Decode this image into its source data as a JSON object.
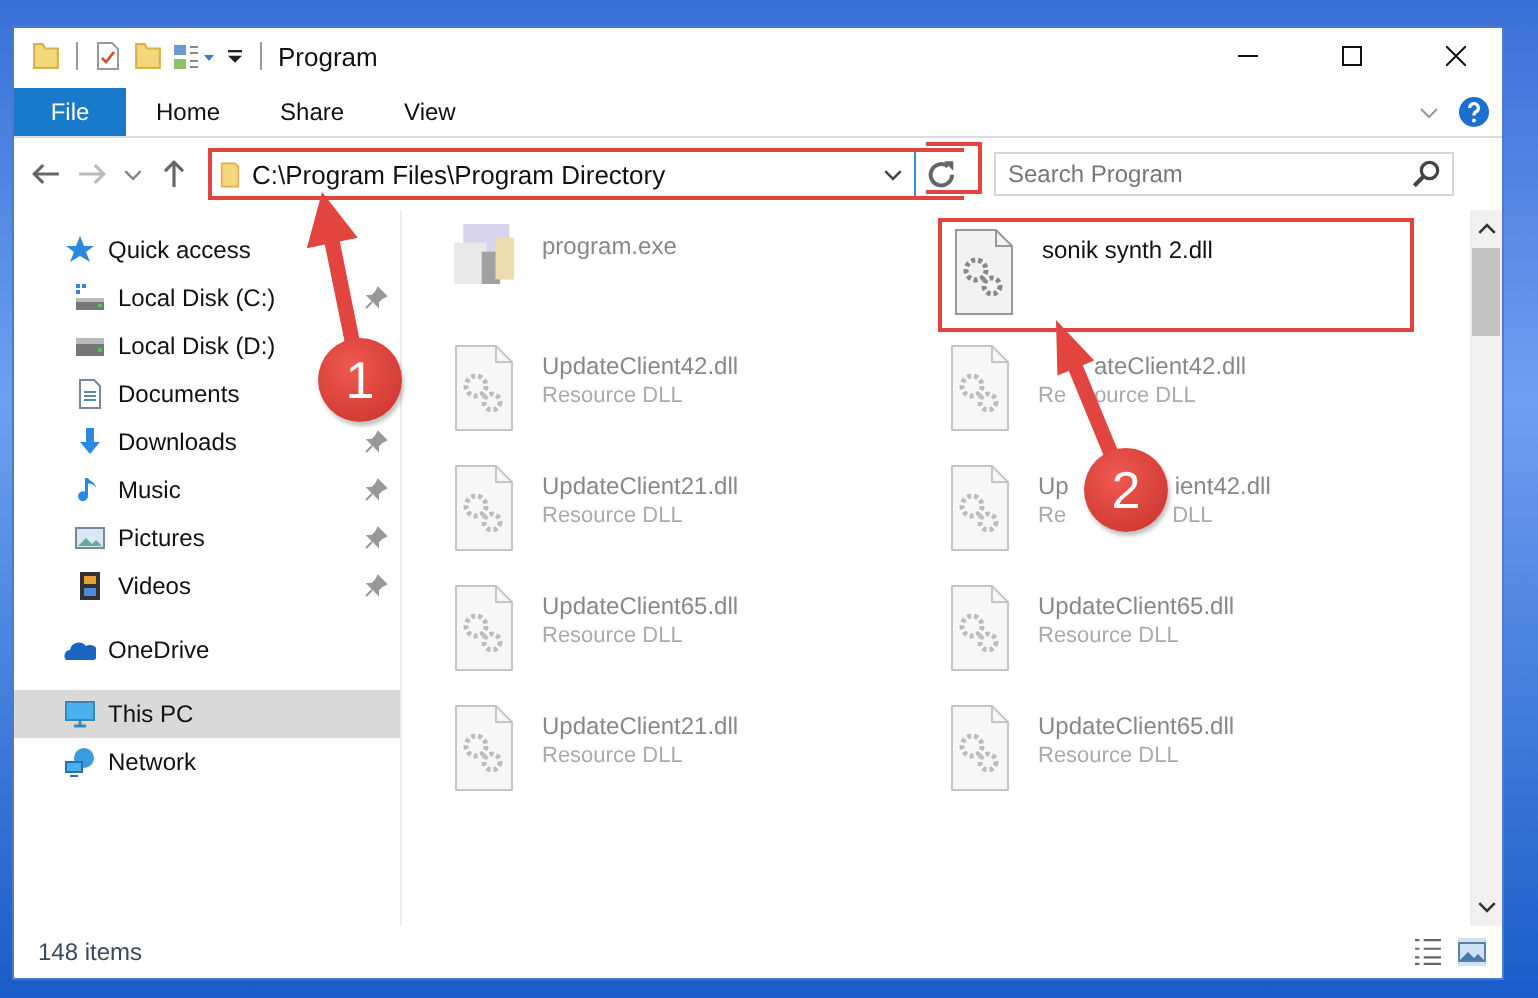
{
  "window": {
    "title": "Program"
  },
  "ribbon_tabs": [
    {
      "label": "File",
      "selected": true
    },
    {
      "label": "Home",
      "selected": false
    },
    {
      "label": "Share",
      "selected": false
    },
    {
      "label": "View",
      "selected": false
    }
  ],
  "address": {
    "path": "C:\\Program Files\\Program Directory"
  },
  "search": {
    "placeholder": "Search Program"
  },
  "sidebar": {
    "items": [
      {
        "label": "Quick access",
        "selected": false,
        "children": [
          {
            "label": "Local Disk (C:)",
            "pinned": true,
            "selected": false
          },
          {
            "label": "Local Disk (D:)",
            "pinned": false,
            "selected": false
          },
          {
            "label": "Documents",
            "pinned": false,
            "selected": false
          },
          {
            "label": "Downloads",
            "pinned": true,
            "selected": false
          },
          {
            "label": "Music",
            "pinned": true,
            "selected": false
          },
          {
            "label": "Pictures",
            "pinned": true,
            "selected": false
          },
          {
            "label": "Videos",
            "pinned": true,
            "selected": false
          }
        ]
      },
      {
        "label": "OneDrive",
        "selected": false
      },
      {
        "label": "This PC",
        "selected": true
      },
      {
        "label": "Network",
        "selected": false
      }
    ]
  },
  "files": [
    {
      "name": [
        "program.exe"
      ],
      "kind": "exe",
      "faded": true,
      "highlighted": false
    },
    {
      "name": [
        "sonik synth 2.dll"
      ],
      "kind": "dll",
      "faded": false,
      "highlighted": true
    },
    {
      "name": [
        "UpdateClient42.dll"
      ],
      "type": [
        "Resource DLL"
      ],
      "kind": "dll",
      "faded": true,
      "highlighted": false
    },
    {
      "name": [
        "ateClient42.dll"
      ],
      "type": [
        "Re",
        "ource DLL"
      ],
      "kind": "dll",
      "faded": true,
      "highlighted": false
    },
    {
      "name": [
        "UpdateClient21.dll"
      ],
      "type": [
        "Resource DLL"
      ],
      "kind": "dll",
      "faded": true,
      "highlighted": false
    },
    {
      "name": [
        "Up",
        "ient42.dll"
      ],
      "type": [
        "Re",
        "DLL"
      ],
      "kind": "dll",
      "faded": true,
      "highlighted": false
    },
    {
      "name": [
        "UpdateClient65.dll"
      ],
      "type": [
        "Resource DLL"
      ],
      "kind": "dll",
      "faded": true,
      "highlighted": false
    },
    {
      "name": [
        "UpdateClient65.dll"
      ],
      "type": [
        "Resource DLL"
      ],
      "kind": "dll",
      "faded": true,
      "highlighted": false
    },
    {
      "name": [
        "UpdateClient21.dll"
      ],
      "type": [
        "Resource DLL"
      ],
      "kind": "dll",
      "faded": true,
      "highlighted": false
    },
    {
      "name": [
        "UpdateClient65.dll"
      ],
      "type": [
        "Resource DLL"
      ],
      "kind": "dll",
      "faded": true,
      "highlighted": false
    }
  ],
  "status_bar": {
    "count": "148 items"
  },
  "annotations": [
    {
      "label": "1"
    },
    {
      "label": "2"
    }
  ]
}
